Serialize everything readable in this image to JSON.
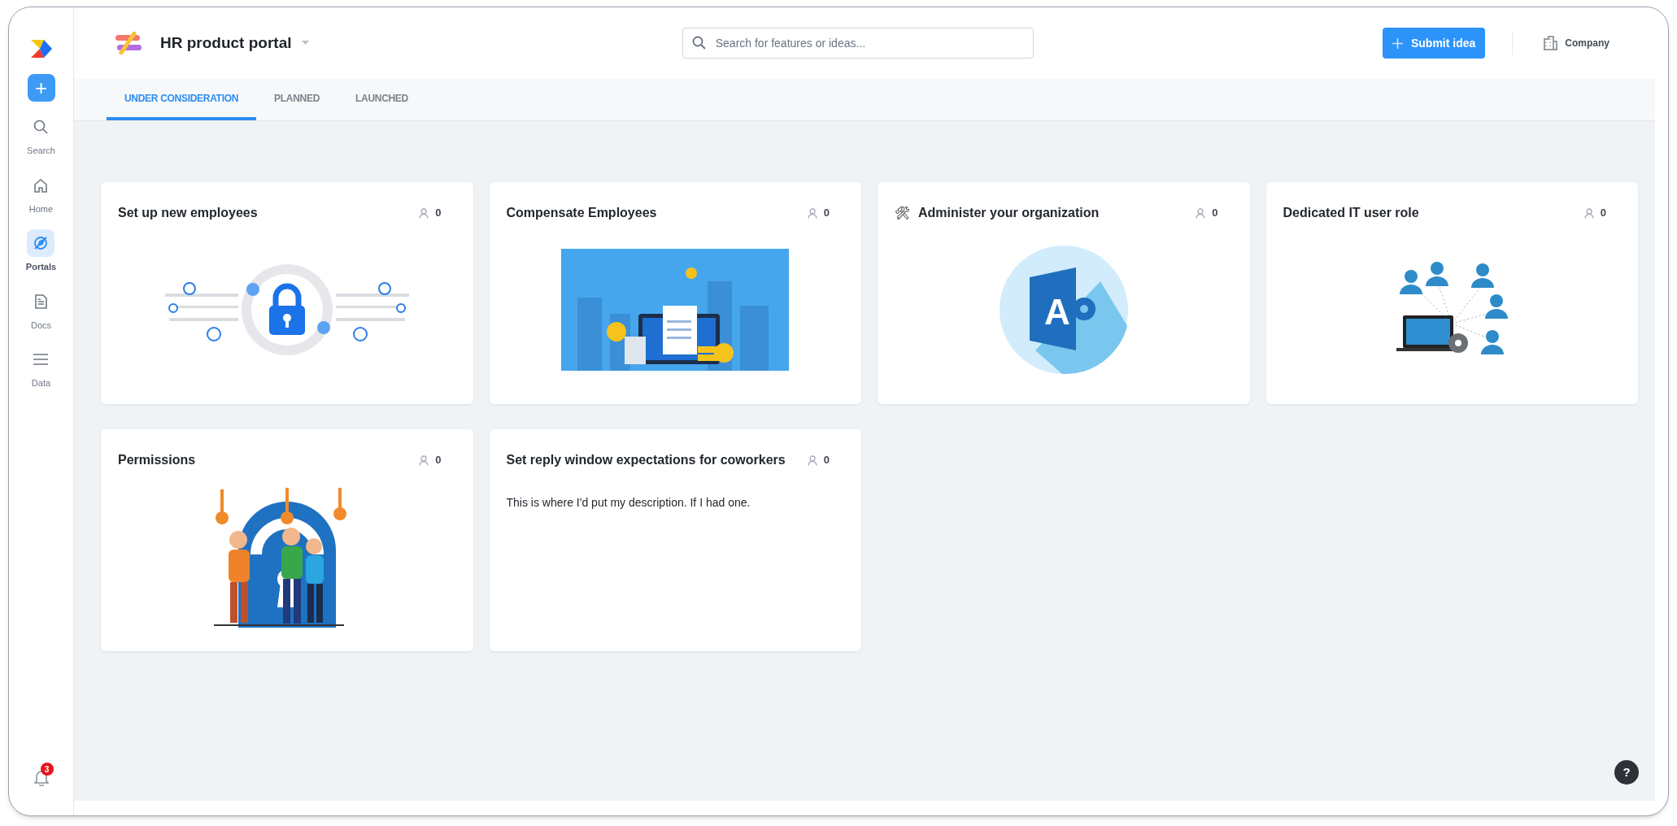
{
  "sidebar": {
    "add_button": "+",
    "items": [
      {
        "kind": "search",
        "label": "Search",
        "selected": false
      },
      {
        "kind": "home",
        "label": "Home",
        "selected": false
      },
      {
        "kind": "portals",
        "label": "Portals",
        "selected": true
      },
      {
        "kind": "docs",
        "label": "Docs",
        "selected": false
      },
      {
        "kind": "data",
        "label": "Data",
        "selected": false
      }
    ],
    "notifications": {
      "count": "3"
    }
  },
  "header": {
    "title": "HR product portal",
    "search": {
      "placeholder": "Search for features or ideas..."
    },
    "submit_button": "Submit idea",
    "company": "Company"
  },
  "tabs": [
    {
      "label": "UNDER CONSIDERATION",
      "selected": true
    },
    {
      "label": "PLANNED",
      "selected": false
    },
    {
      "label": "LAUNCHED",
      "selected": false
    }
  ],
  "cards": [
    {
      "title": "Set up new employees",
      "votes": "0",
      "kind": "lock"
    },
    {
      "title": "Compensate Employees",
      "votes": "0",
      "kind": "salary"
    },
    {
      "icon": "🛠",
      "title": "Administer your organization",
      "votes": "0",
      "kind": "app",
      "image_text": "A"
    },
    {
      "title": "Dedicated IT user role",
      "votes": "0",
      "kind": "network"
    },
    {
      "title": "Permissions",
      "votes": "0",
      "kind": "keys"
    },
    {
      "title": "Set reply window expectations for coworkers",
      "votes": "0",
      "description": "This is where I'd put my description. If I had one."
    }
  ],
  "help_button": "?"
}
